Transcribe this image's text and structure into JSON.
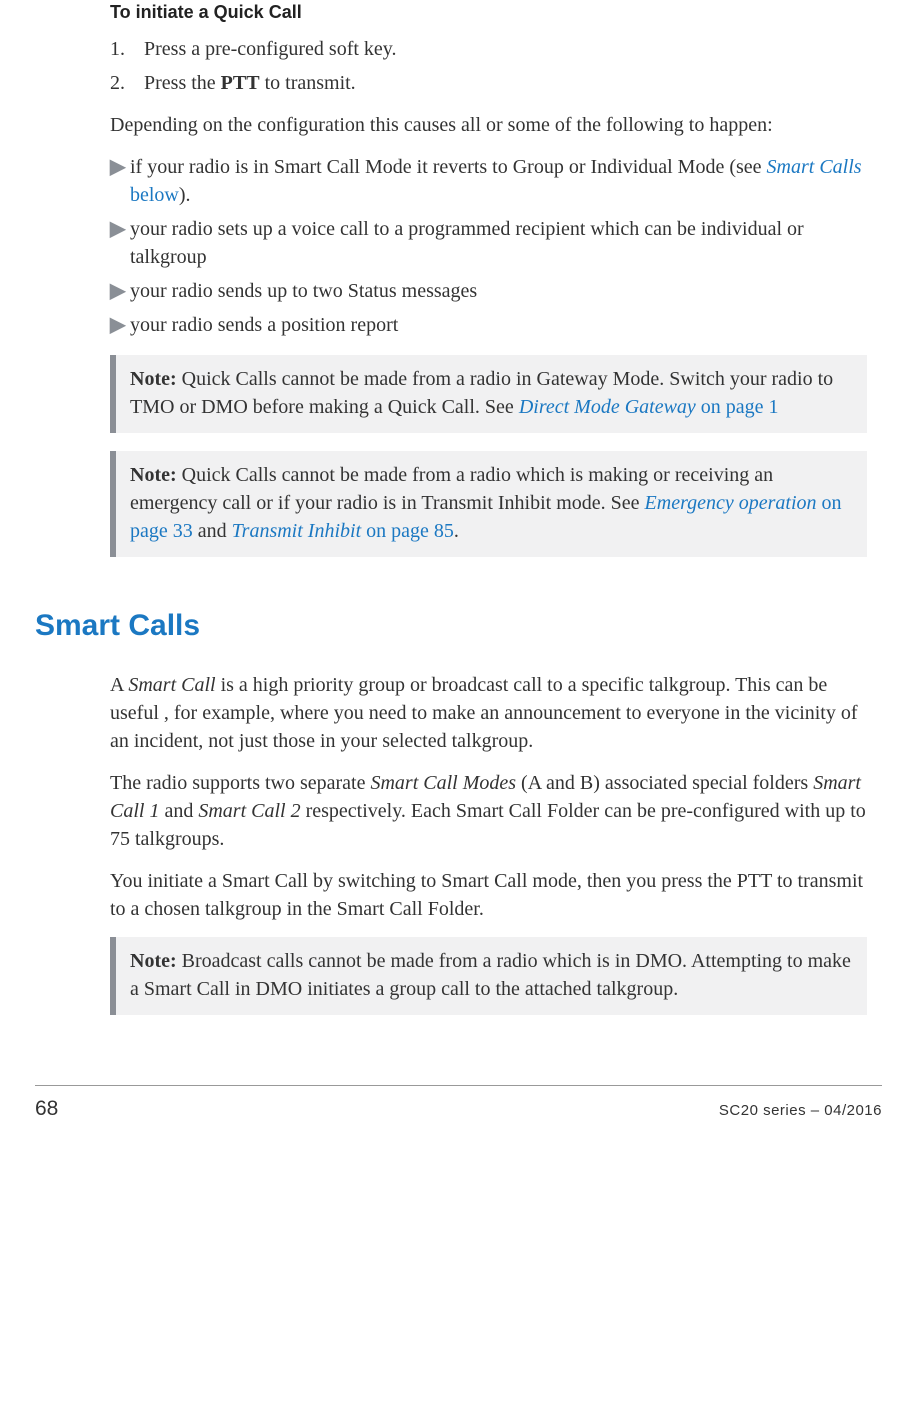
{
  "quick_call": {
    "heading": "To initiate a Quick Call",
    "steps": [
      {
        "num": "1.",
        "text": "Press a pre-configured soft key."
      },
      {
        "num": "2.",
        "prefix": "Press the ",
        "bold": "PTT",
        "suffix": " to transmit."
      }
    ],
    "intro": "Depending on the configuration this causes all or some of the following to happen:",
    "bullets": {
      "b1_prefix": "if your radio is in Smart Call Mode it reverts to Group or Individual Mode (see ",
      "b1_link_italic": "Smart Calls",
      "b1_link_plain": " below",
      "b1_suffix": ").",
      "b2": "your radio sets up a voice call to a programmed recipient which can be individual or talkgroup",
      "b3": "your radio sends up to two Status messages",
      "b4": "your radio sends a position report"
    },
    "note1": {
      "label": "Note:",
      "text_before": "  Quick Calls cannot be made from a radio in Gateway Mode. Switch your radio to TMO or DMO before making a Quick Call. See ",
      "link_italic": "Direct Mode Gateway",
      "link_plain": "  on page 1"
    },
    "note2": {
      "label": "Note:",
      "text_before": "  Quick Calls cannot be made from a radio which is making or receiving an emergency call or if your radio is in Transmit Inhibit mode. See ",
      "link1_italic": "Emergency operation",
      "link1_plain": " on page 33",
      "mid": " and ",
      "link2_italic": "Transmit Inhibit",
      "link2_plain": "  on page 85",
      "end": "."
    }
  },
  "smart_calls": {
    "title": "Smart Calls",
    "p1": {
      "a": "A ",
      "i1": "Smart Call",
      "b": " is a high priority group or broadcast call to a specific talkgroup. This can be useful , for example, where you need to make an announcement to everyone in the vicinity of an incident, not just those in your selected talkgroup."
    },
    "p2": {
      "a": "The radio supports two separate ",
      "i1": "Smart Call Modes",
      "b": " (A and B) associated special folders ",
      "i2": "Smart Call 1",
      "c": " and ",
      "i3": "Smart Call 2",
      "d": " respectively. Each Smart Call Folder can be pre-configured with up to 75 talkgroups."
    },
    "p3": "You initiate a Smart Call by switching to Smart Call mode, then you press the PTT to transmit to a chosen talkgroup in the Smart Call Folder.",
    "note": {
      "label": "Note:",
      "text": "  Broadcast calls cannot be made from a radio which is in DMO. Attempting to make a Smart Call in DMO initiates a group call to the attached talkgroup."
    }
  },
  "footer": {
    "page": "68",
    "docinfo": "SC20 series – 04/2016"
  }
}
